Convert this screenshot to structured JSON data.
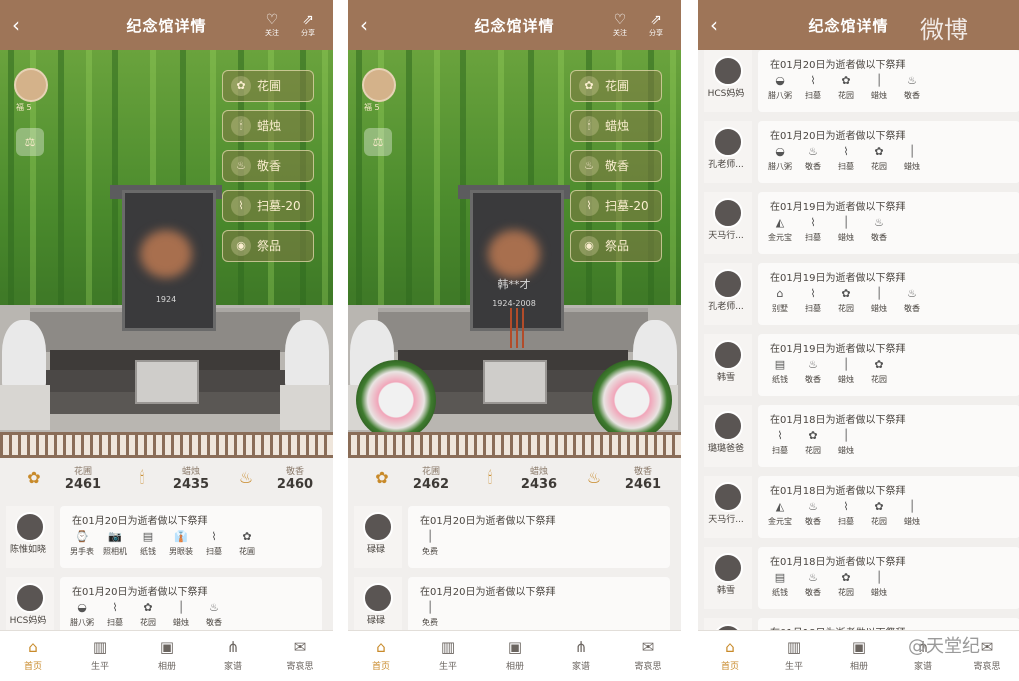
{
  "common": {
    "title": "纪念馆详情",
    "back_icon": "‹",
    "follow_label": "关注",
    "share_label": "分享",
    "offer_buttons": [
      "花圃",
      "蜡烛",
      "敬香",
      "扫墓-20",
      "祭品"
    ],
    "level_label": "福 5",
    "tabs": [
      "首页",
      "生平",
      "相册",
      "家谱",
      "寄哀思"
    ]
  },
  "panel1": {
    "stats": [
      {
        "label": "花圃",
        "value": "2461"
      },
      {
        "label": "蜡烛",
        "value": "2435"
      },
      {
        "label": "敬香",
        "value": "2460"
      }
    ],
    "plaque_text": "1924",
    "records": [
      {
        "name": "陈惟如晓",
        "text": "在01月20日为逝者做以下祭拜",
        "items": [
          "男手表",
          "照相机",
          "纸钱",
          "男眼装",
          "扫墓",
          "花圃"
        ]
      },
      {
        "name": "HCS妈妈",
        "text": "在01月20日为逝者做以下祭拜",
        "items": [
          "腊八粥",
          "扫墓",
          "花园",
          "蜡烛",
          "敬香"
        ]
      }
    ]
  },
  "panel2": {
    "stats": [
      {
        "label": "花圃",
        "value": "2462"
      },
      {
        "label": "蜡烛",
        "value": "2436"
      },
      {
        "label": "敬香",
        "value": "2461"
      }
    ],
    "plaque_name": "韩**才",
    "plaque_text": "1924-2008",
    "records": [
      {
        "name": "碌碌",
        "text": "在01月20日为逝者做以下祭拜",
        "items": [
          "免费"
        ]
      },
      {
        "name": "碌碌",
        "text": "在01月20日为逝者做以下祭拜",
        "items": [
          "免费"
        ]
      }
    ]
  },
  "panel3": {
    "records": [
      {
        "name": "HCS妈妈",
        "text": "在01月20日为逝者做以下祭拜",
        "items": [
          "腊八粥",
          "扫墓",
          "花园",
          "蜡烛",
          "敬香"
        ]
      },
      {
        "name": "孔老师...",
        "text": "在01月20日为逝者做以下祭拜",
        "items": [
          "腊八粥",
          "敬香",
          "扫墓",
          "花园",
          "蜡烛"
        ]
      },
      {
        "name": "天马行...",
        "text": "在01月19日为逝者做以下祭拜",
        "items": [
          "金元宝",
          "扫墓",
          "蜡烛",
          "敬香"
        ]
      },
      {
        "name": "孔老师...",
        "text": "在01月19日为逝者做以下祭拜",
        "items": [
          "别墅",
          "扫墓",
          "花园",
          "蜡烛",
          "敬香"
        ]
      },
      {
        "name": "韩雪",
        "text": "在01月19日为逝者做以下祭拜",
        "items": [
          "纸钱",
          "敬香",
          "蜡烛",
          "花园"
        ]
      },
      {
        "name": "璐璐爸爸",
        "text": "在01月18日为逝者做以下祭拜",
        "items": [
          "扫墓",
          "花园",
          "蜡烛"
        ]
      },
      {
        "name": "天马行...",
        "text": "在01月18日为逝者做以下祭拜",
        "items": [
          "金元宝",
          "敬香",
          "扫墓",
          "花园",
          "蜡烛"
        ]
      },
      {
        "name": "韩雪",
        "text": "在01月18日为逝者做以下祭拜",
        "items": [
          "纸钱",
          "敬香",
          "花园",
          "蜡烛"
        ]
      },
      {
        "name": "",
        "text": "在01月18日为逝者做以下祭拜",
        "items": []
      }
    ]
  },
  "watermarks": {
    "top": "微博",
    "bottom": "@天堂纪"
  }
}
